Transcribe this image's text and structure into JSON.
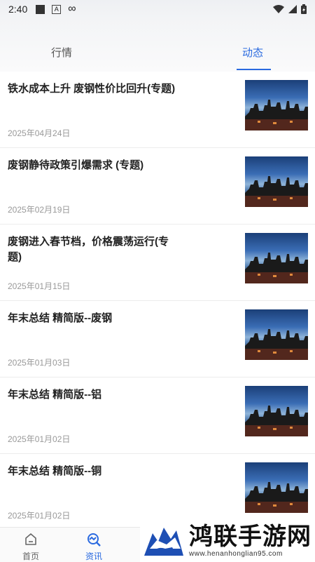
{
  "status_bar": {
    "time": "2:40",
    "icons": [
      "notification-square-icon",
      "a-icon",
      "infinity-icon",
      "wifi-icon",
      "signal-icon",
      "battery-icon"
    ]
  },
  "tabs": [
    {
      "label": "行情",
      "active": false
    },
    {
      "label": "动态",
      "active": true
    }
  ],
  "colors": {
    "accent": "#2a6ae0",
    "date": "#999999"
  },
  "articles": [
    {
      "title": "铁水成本上升 废钢性价比回升(专题)",
      "date": "2025年04月24日"
    },
    {
      "title": "废钢静待政策引爆需求 (专题)",
      "date": "2025年02月19日"
    },
    {
      "title": "废钢进入春节档，价格震荡运行(专题)",
      "date": "2025年01月15日"
    },
    {
      "title": "年末总结 精简版--废钢",
      "date": "2025年01月03日"
    },
    {
      "title": "年末总结 精简版--铝",
      "date": "2025年01月02日"
    },
    {
      "title": "年末总结 精简版--铜",
      "date": "2025年01月02日"
    }
  ],
  "bottom_nav": [
    {
      "label": "首页",
      "icon": "home-icon",
      "active": false
    },
    {
      "label": "资讯",
      "icon": "news-icon",
      "active": true
    }
  ],
  "watermark": {
    "title": "鸿联手游网",
    "url": "www.henanhonglian95.com"
  }
}
